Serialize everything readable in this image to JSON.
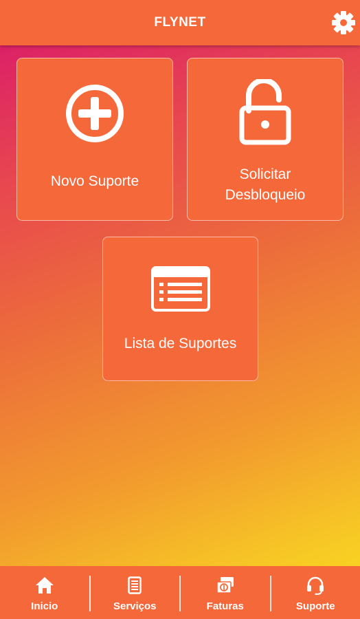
{
  "header": {
    "title": "FLYNET",
    "settings_icon": "gear-icon"
  },
  "tiles": [
    {
      "label": "Novo Suporte",
      "icon": "plus-circle-icon"
    },
    {
      "label": "Solicitar\nDesbloqueio",
      "icon": "unlocked-padlock-icon"
    },
    {
      "label": "Lista de Suportes",
      "icon": "list-card-icon"
    }
  ],
  "bottom_nav": [
    {
      "label": "Inicio",
      "icon": "home-icon"
    },
    {
      "label": "Serviços",
      "icon": "document-icon"
    },
    {
      "label": "Faturas",
      "icon": "money-icon"
    },
    {
      "label": "Suporte",
      "icon": "headset-icon"
    }
  ],
  "colors": {
    "primary": "#f4683a",
    "gradient_top": "#d8146f",
    "gradient_bottom": "#fbde1e",
    "text": "#ffffff"
  }
}
